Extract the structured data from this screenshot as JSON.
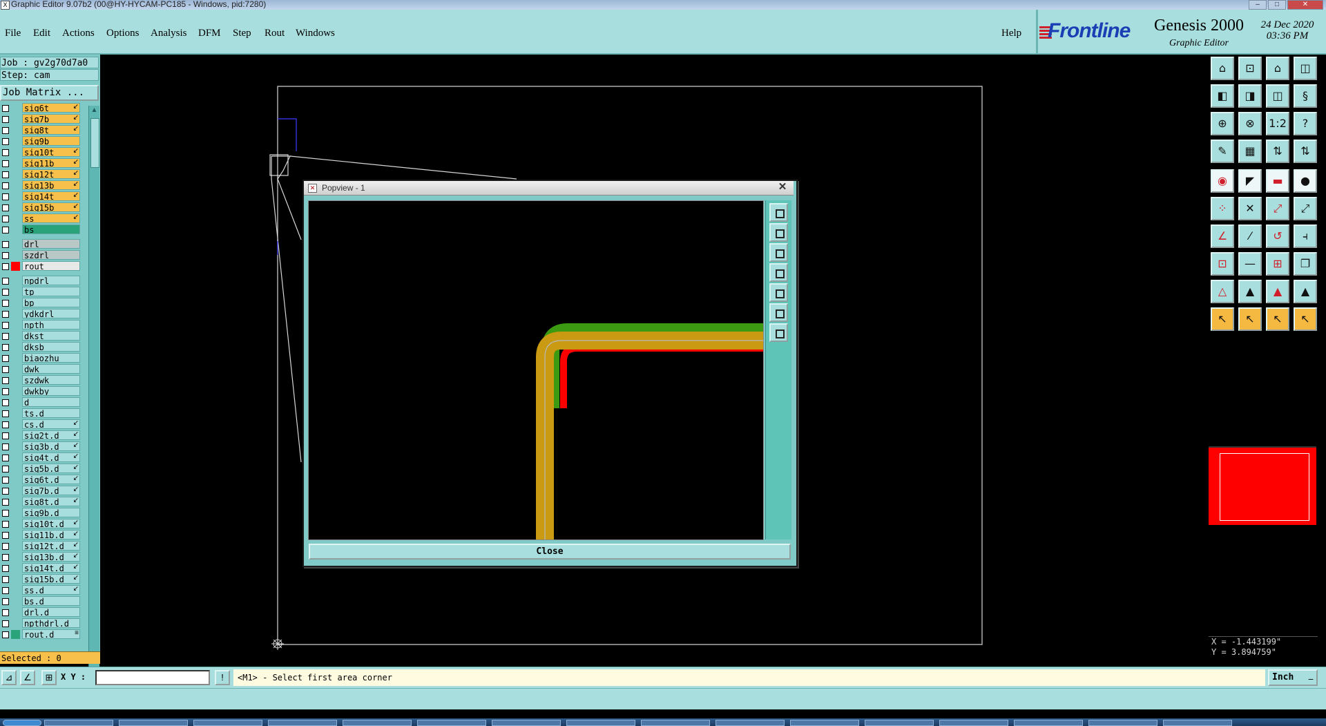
{
  "window": {
    "title": "Graphic Editor 9.07b2 (00@HY-HYCAM-PC185 - Windows, pid:7280)"
  },
  "menu": [
    "File",
    "Edit",
    "Actions",
    "Options",
    "Analysis",
    "DFM",
    "Step",
    "Rout",
    "Windows"
  ],
  "help": "Help",
  "brand": {
    "logo": "Frontline",
    "product": "Genesis 2000",
    "subtitle": "Graphic Editor",
    "date": "24 Dec 2020",
    "time": "03:36 PM"
  },
  "job": {
    "job": "Job : gv2g70d7a0",
    "step": "Step: cam",
    "matrix": "Job Matrix ..."
  },
  "layers": [
    {
      "name": "sig6t",
      "color": "#f7c04b",
      "flag": "↙"
    },
    {
      "name": "sig7b",
      "color": "#f7c04b",
      "flag": "↙"
    },
    {
      "name": "sig8t",
      "color": "#f7c04b",
      "flag": "↙"
    },
    {
      "name": "sig9b",
      "color": "#f7c04b",
      "flag": ""
    },
    {
      "name": "sig10t",
      "color": "#f7c04b",
      "flag": "↙"
    },
    {
      "name": "sig11b",
      "color": "#f7c04b",
      "flag": "↙"
    },
    {
      "name": "sig12t",
      "color": "#f7c04b",
      "flag": "↙"
    },
    {
      "name": "sig13b",
      "color": "#f7c04b",
      "flag": "↙"
    },
    {
      "name": "sig14t",
      "color": "#f7c04b",
      "flag": "↙"
    },
    {
      "name": "sig15b",
      "color": "#f7c04b",
      "flag": "↙"
    },
    {
      "name": "ss",
      "color": "#f7c04b",
      "flag": "↙"
    },
    {
      "name": "bs",
      "color": "#2aa37a",
      "flag": ""
    },
    {
      "name": "drl",
      "color": "#b9c7c7",
      "flag": ""
    },
    {
      "name": "szdrl",
      "color": "#b9c7c7",
      "flag": ""
    },
    {
      "name": "rout",
      "color": "#e8e8e8",
      "flag": "",
      "swatch": "#ff0000"
    },
    {
      "name": "npdrl",
      "color": "#a8dedd",
      "flag": ""
    },
    {
      "name": "tp",
      "color": "#a8dedd",
      "flag": ""
    },
    {
      "name": "bp",
      "color": "#a8dedd",
      "flag": ""
    },
    {
      "name": "ydkdrl",
      "color": "#a8dedd",
      "flag": ""
    },
    {
      "name": "npth",
      "color": "#a8dedd",
      "flag": ""
    },
    {
      "name": "dkst",
      "color": "#a8dedd",
      "flag": ""
    },
    {
      "name": "dksb",
      "color": "#a8dedd",
      "flag": ""
    },
    {
      "name": "biaozhu",
      "color": "#a8dedd",
      "flag": ""
    },
    {
      "name": "dwk",
      "color": "#a8dedd",
      "flag": ""
    },
    {
      "name": "szdwk",
      "color": "#a8dedd",
      "flag": ""
    },
    {
      "name": "dwkby",
      "color": "#a8dedd",
      "flag": ""
    },
    {
      "name": "d",
      "color": "#a8dedd",
      "flag": ""
    },
    {
      "name": "ts.d",
      "color": "#a8dedd",
      "flag": ""
    },
    {
      "name": "cs.d",
      "color": "#a8dedd",
      "flag": "↙"
    },
    {
      "name": "sig2t.d",
      "color": "#a8dedd",
      "flag": "↙"
    },
    {
      "name": "sig3b.d",
      "color": "#a8dedd",
      "flag": "↙"
    },
    {
      "name": "sig4t.d",
      "color": "#a8dedd",
      "flag": "↙"
    },
    {
      "name": "sig5b.d",
      "color": "#a8dedd",
      "flag": "↙"
    },
    {
      "name": "sig6t.d",
      "color": "#a8dedd",
      "flag": "↙"
    },
    {
      "name": "sig7b.d",
      "color": "#a8dedd",
      "flag": "↙"
    },
    {
      "name": "sig8t.d",
      "color": "#a8dedd",
      "flag": "↙"
    },
    {
      "name": "sig9b.d",
      "color": "#a8dedd",
      "flag": ""
    },
    {
      "name": "sig10t.d",
      "color": "#a8dedd",
      "flag": "↙"
    },
    {
      "name": "sig11b.d",
      "color": "#a8dedd",
      "flag": "↙"
    },
    {
      "name": "sig12t.d",
      "color": "#a8dedd",
      "flag": "↙"
    },
    {
      "name": "sig13b.d",
      "color": "#a8dedd",
      "flag": "↙"
    },
    {
      "name": "sig14t.d",
      "color": "#a8dedd",
      "flag": "↙"
    },
    {
      "name": "sig15b.d",
      "color": "#a8dedd",
      "flag": "↙"
    },
    {
      "name": "ss.d",
      "color": "#a8dedd",
      "flag": "↙"
    },
    {
      "name": "bs.d",
      "color": "#a8dedd",
      "flag": ""
    },
    {
      "name": "drl.d",
      "color": "#a8dedd",
      "flag": ""
    },
    {
      "name": "npthdrl.d",
      "color": "#a8dedd",
      "flag": ""
    },
    {
      "name": "rout.d",
      "color": "#a8dedd",
      "flag": "≡",
      "swatch": "#2aa37a"
    }
  ],
  "selected": "Selected : 0",
  "popview": {
    "title": "Popview - 1",
    "close": "Close"
  },
  "coords": {
    "x": "X = -1.443199\"",
    "y": "Y = 3.894759\""
  },
  "status": {
    "xy_label": "X Y :",
    "xy_value": "",
    "prompt": "<M1> - Select first area corner",
    "units": "Inch"
  },
  "colors": {
    "panel": "#a8dedd",
    "signal_layer": "#f7c04b",
    "trace": "#c99a12",
    "accent_red": "#ff0000",
    "accent_green": "#3c9a12"
  }
}
